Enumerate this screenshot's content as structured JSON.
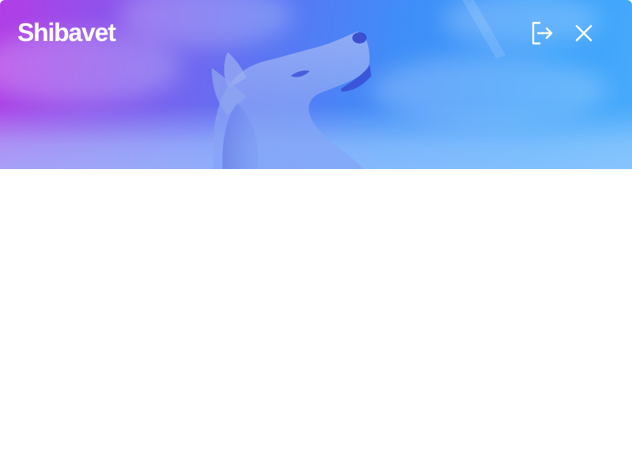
{
  "app": {
    "title": "Shibavet"
  },
  "header": {
    "gradient_start": "#b23de6",
    "gradient_end": "#49abfb",
    "background_image": "shiba-inu-dog-howling-in-snow"
  },
  "actions": {
    "logout_icon": "logout-icon",
    "close_icon": "close-icon"
  }
}
